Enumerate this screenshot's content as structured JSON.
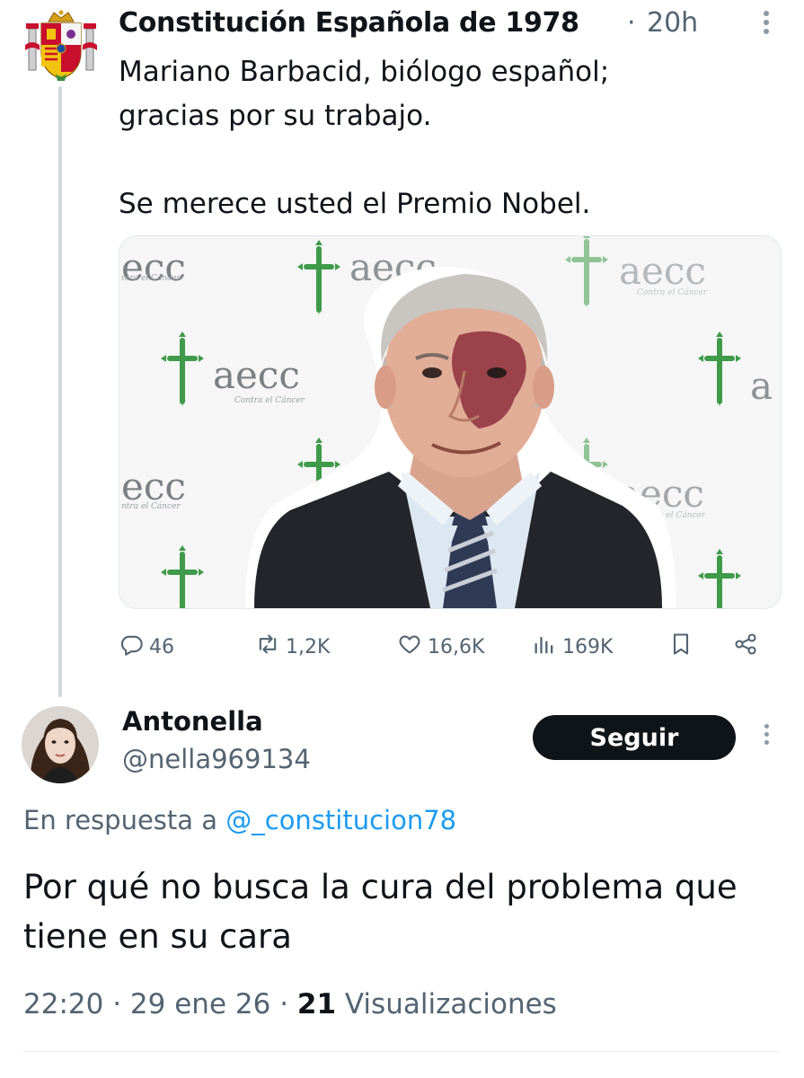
{
  "parent": {
    "author": "Constitución Española de 1978",
    "separator": "·",
    "time": "20h",
    "lines": [
      "Mariano Barbacid, biólogo español;",
      "gracias por su trabajo.",
      "Se merece usted el Premio Nobel."
    ],
    "media_banner": {
      "brand": "aecc",
      "brand_left": "ecc",
      "brand_right": "a",
      "tagline": "Contra el Cáncer",
      "tagline_left": "ntra el Cáncer",
      "accent_color": "#3f9a4a"
    },
    "actions": {
      "replies": "46",
      "reposts": "1,2K",
      "likes": "16,6K",
      "views": "169K"
    },
    "icons": [
      "reply-icon",
      "repost-icon",
      "like-icon",
      "views-icon",
      "bookmark-icon",
      "share-icon",
      "more-icon",
      "coat-of-arms-icon"
    ]
  },
  "reply": {
    "name": "Antonella",
    "handle": "@nella969134",
    "follow_label": "Seguir",
    "reply_prefix": "En respuesta a ",
    "reply_mention": "@_constitucion78",
    "text": "Por qué no busca la cura del problema que tiene en su cara",
    "time": "22:20",
    "date": "29 ene 26",
    "sep": "·",
    "views_count": "21",
    "views_label": "Visualizaciones"
  },
  "colors": {
    "text": "#0f1419",
    "muted": "#536471",
    "link": "#1d9bf0",
    "thread_line": "#cfd9de"
  }
}
